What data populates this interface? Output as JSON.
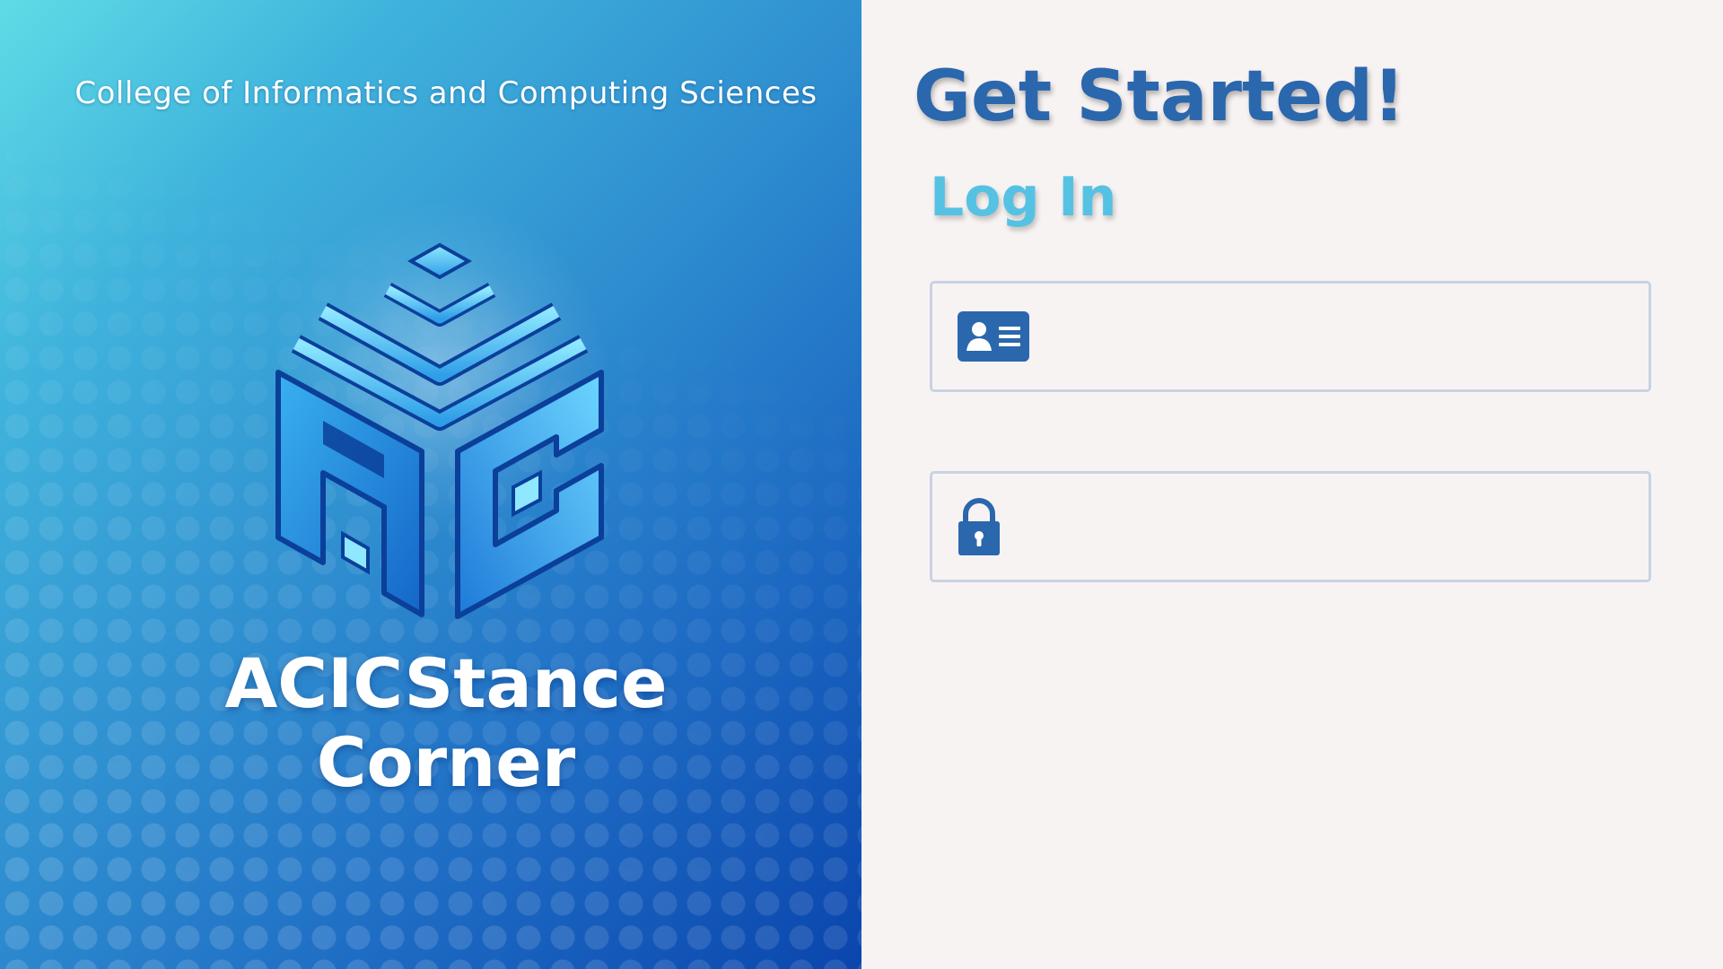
{
  "brand": {
    "college_name": "College of Informatics and Computing Sciences",
    "app_title_line1": "ACICStance",
    "app_title_line2": "Corner",
    "logo_icon": "acic-cube-logo"
  },
  "login": {
    "heading": "Get Started!",
    "subheading": "Log In",
    "username_field": {
      "icon": "id-card-icon",
      "value": "",
      "placeholder": ""
    },
    "password_field": {
      "icon": "lock-icon",
      "value": "",
      "placeholder": ""
    }
  },
  "colors": {
    "primary": "#2a67ad",
    "accent": "#56c2e3",
    "panel_background": "#f8f3f3",
    "field_border": "#c8d3e1"
  }
}
